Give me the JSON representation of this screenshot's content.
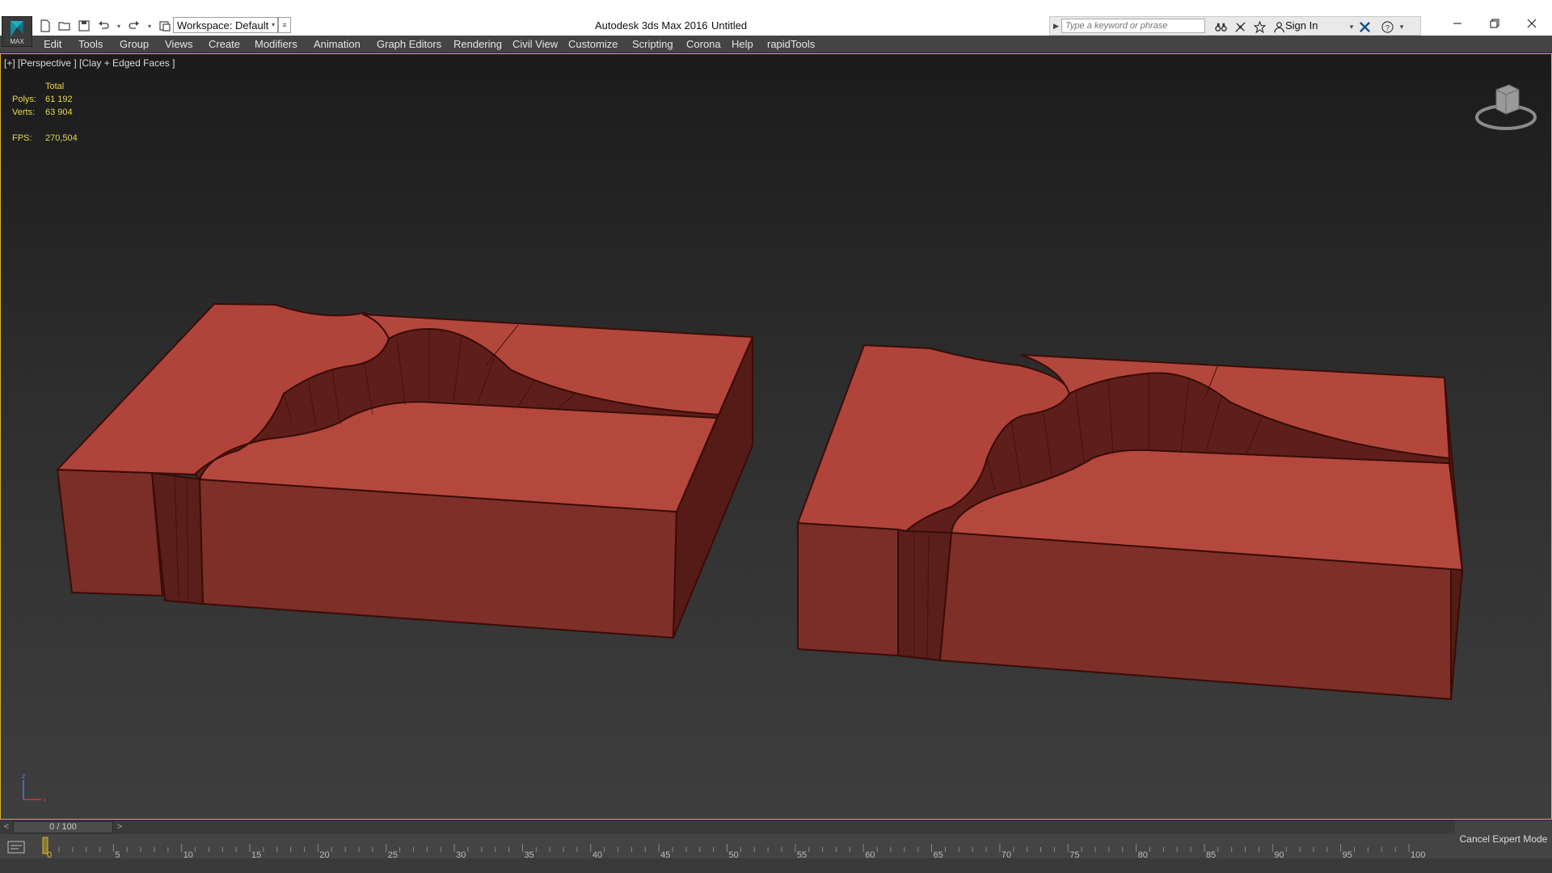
{
  "window": {
    "app_title": "Autodesk 3ds Max 2016",
    "doc_title": "Untitled",
    "logo_text": "MAX"
  },
  "workspace": {
    "selected": "Workspace: Default"
  },
  "infocenter": {
    "search_placeholder": "Type a keyword or phrase",
    "signin_label": "Sign In"
  },
  "menu": {
    "items": [
      "Edit",
      "Tools",
      "Group",
      "Views",
      "Create",
      "Modifiers",
      "Animation",
      "Graph Editors",
      "Rendering",
      "Civil View",
      "Customize",
      "Scripting",
      "Corona",
      "Help",
      "rapidTools"
    ]
  },
  "viewport": {
    "label": "[+] [Perspective ] [Clay + Edged Faces ]",
    "stats": {
      "total_label": "Total",
      "polys_label": "Polys:",
      "polys_value": "61 192",
      "verts_label": "Verts:",
      "verts_value": "63 904",
      "fps_label": "FPS:",
      "fps_value": "270,504"
    },
    "axis": {
      "z": "z",
      "x": "x"
    },
    "mesh_color": "#b0443a"
  },
  "timeline": {
    "frame_display": "0 / 100",
    "prev": "<",
    "next": ">",
    "ticks": [
      "0",
      "5",
      "10",
      "15",
      "20",
      "25",
      "30",
      "35",
      "40",
      "45",
      "50",
      "55",
      "60",
      "65",
      "70",
      "75",
      "80",
      "85",
      "90",
      "95",
      "100"
    ]
  },
  "expert_mode": {
    "label": "Cancel Expert Mode"
  },
  "colors": {
    "accent": "#d9b233",
    "stats_text": "#e8d84b"
  }
}
